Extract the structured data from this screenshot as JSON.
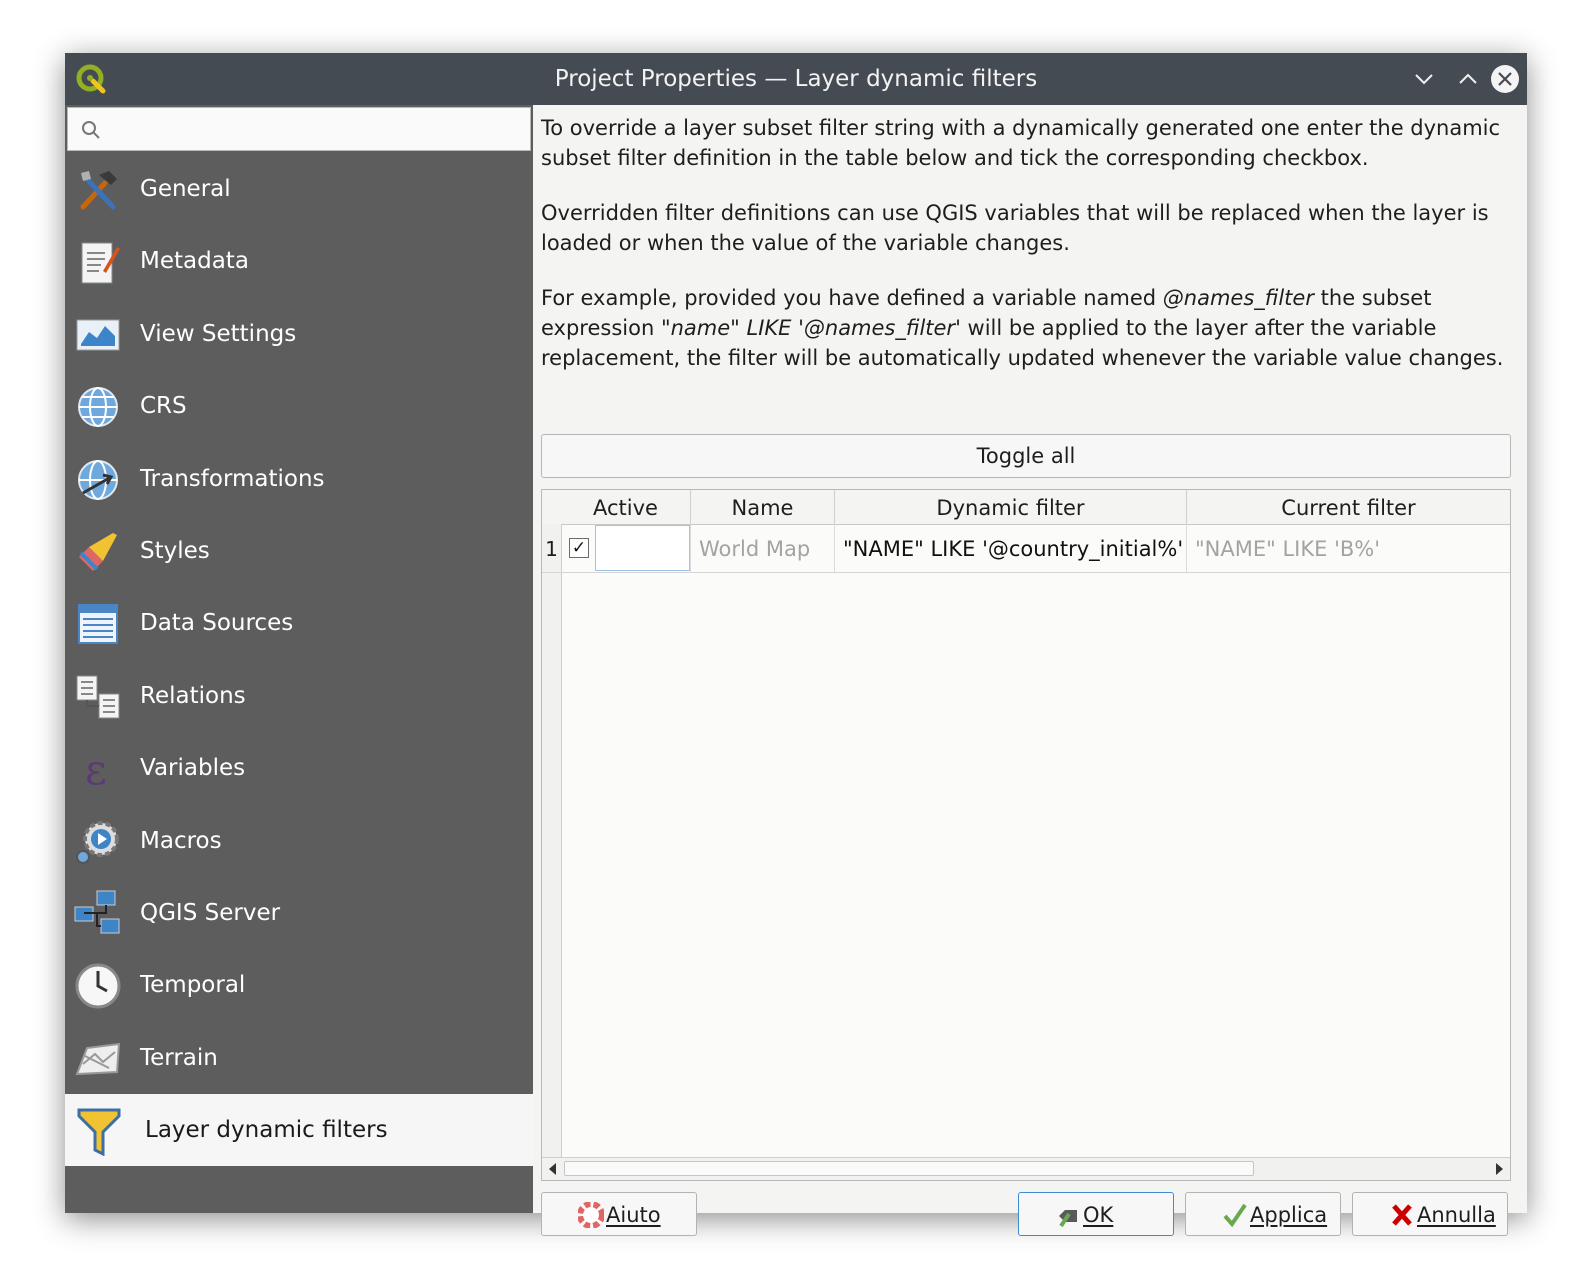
{
  "window": {
    "title": "Project Properties — Layer dynamic filters"
  },
  "search": {
    "value": "",
    "placeholder": ""
  },
  "sidebar": {
    "items": [
      {
        "label": "General",
        "icon": "tools-icon"
      },
      {
        "label": "Metadata",
        "icon": "metadata-icon"
      },
      {
        "label": "View Settings",
        "icon": "map-view-icon"
      },
      {
        "label": "CRS",
        "icon": "globe-icon"
      },
      {
        "label": "Transformations",
        "icon": "globe-transform-icon"
      },
      {
        "label": "Styles",
        "icon": "brush-icon"
      },
      {
        "label": "Data Sources",
        "icon": "table-icon"
      },
      {
        "label": "Relations",
        "icon": "relations-icon"
      },
      {
        "label": "Variables",
        "icon": "epsilon-icon"
      },
      {
        "label": "Macros",
        "icon": "gear-play-icon"
      },
      {
        "label": "QGIS Server",
        "icon": "network-icon"
      },
      {
        "label": "Temporal",
        "icon": "clock-icon"
      },
      {
        "label": "Terrain",
        "icon": "terrain-icon"
      },
      {
        "label": "Layer dynamic filters",
        "icon": "filter-funnel-icon",
        "selected": true
      }
    ]
  },
  "description": {
    "p1": "To override a layer subset filter string with a dynamically generated one enter the dynamic subset filter definition in the table below and tick the corresponding checkbox.",
    "p2": "Overridden filter definitions can use QGIS variables that will be replaced when the layer is loaded or when the value of the variable changes.",
    "p3_a": "For example, provided you have defined a variable named ",
    "p3_var": "@names_filter",
    "p3_b": " the subset expression ",
    "p3_expr": "\"name\" LIKE '@names_filter'",
    "p3_c": " will be applied to the layer after the variable replacement, the filter will be automatically updated whenever the variable value changes."
  },
  "toggle_all_label": "Toggle all",
  "table": {
    "columns": [
      "Active",
      "Name",
      "Dynamic filter",
      "Current filter"
    ],
    "rows": [
      {
        "num": "1",
        "active": true,
        "name": "World Map",
        "dynamic_filter": "\"NAME\"  LIKE '@country_initial%'",
        "current_filter": "\"NAME\"  LIKE 'B%'"
      }
    ]
  },
  "buttons": {
    "help": "Aiuto",
    "ok": "OK",
    "apply": "Applica",
    "cancel": "Annulla"
  },
  "colors": {
    "titlebar": "#454b52",
    "sidebar": "#5d5d5d",
    "ok_border": "#3f8bd4"
  }
}
